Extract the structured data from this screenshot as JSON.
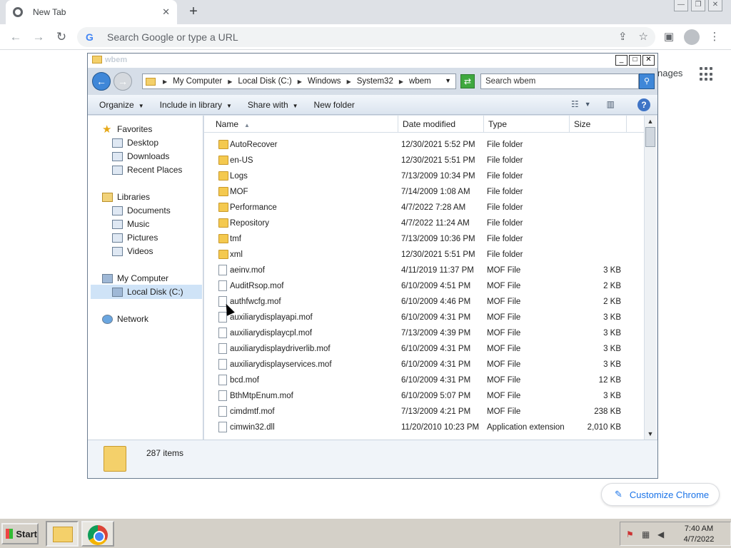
{
  "chrome": {
    "tab_title": "New Tab",
    "tab_close": "✕",
    "new_tab": "+",
    "omnibox_placeholder": "Search Google or type a URL",
    "images_link": "nages",
    "customize_label": "Customize Chrome"
  },
  "explorer": {
    "title": "wbem",
    "breadcrumbs": [
      "My Computer",
      "Local Disk (C:)",
      "Windows",
      "System32",
      "wbem"
    ],
    "search_placeholder": "Search wbem",
    "commands": {
      "organize": "Organize",
      "include": "Include in library",
      "share": "Share with",
      "new_folder": "New folder"
    },
    "nav": {
      "favorites": "Favorites",
      "desktop": "Desktop",
      "downloads": "Downloads",
      "recent": "Recent Places",
      "libraries": "Libraries",
      "documents": "Documents",
      "music": "Music",
      "pictures": "Pictures",
      "videos": "Videos",
      "my_computer": "My Computer",
      "local_disk": "Local Disk (C:)",
      "network": "Network"
    },
    "columns": {
      "name": "Name",
      "date": "Date modified",
      "type": "Type",
      "size": "Size"
    },
    "files": [
      {
        "name": "AutoRecover",
        "date": "12/30/2021 5:52 PM",
        "type": "File folder",
        "size": "",
        "kind": "folder"
      },
      {
        "name": "en-US",
        "date": "12/30/2021 5:51 PM",
        "type": "File folder",
        "size": "",
        "kind": "folder"
      },
      {
        "name": "Logs",
        "date": "7/13/2009 10:34 PM",
        "type": "File folder",
        "size": "",
        "kind": "folder"
      },
      {
        "name": "MOF",
        "date": "7/14/2009 1:08 AM",
        "type": "File folder",
        "size": "",
        "kind": "folder"
      },
      {
        "name": "Performance",
        "date": "4/7/2022 7:28 AM",
        "type": "File folder",
        "size": "",
        "kind": "folder"
      },
      {
        "name": "Repository",
        "date": "4/7/2022 11:24 AM",
        "type": "File folder",
        "size": "",
        "kind": "folder"
      },
      {
        "name": "tmf",
        "date": "7/13/2009 10:36 PM",
        "type": "File folder",
        "size": "",
        "kind": "folder"
      },
      {
        "name": "xml",
        "date": "12/30/2021 5:51 PM",
        "type": "File folder",
        "size": "",
        "kind": "folder"
      },
      {
        "name": "aeinv.mof",
        "date": "4/11/2019 11:37 PM",
        "type": "MOF File",
        "size": "3 KB",
        "kind": "file"
      },
      {
        "name": "AuditRsop.mof",
        "date": "6/10/2009 4:51 PM",
        "type": "MOF File",
        "size": "2 KB",
        "kind": "file"
      },
      {
        "name": "authfwcfg.mof",
        "date": "6/10/2009 4:46 PM",
        "type": "MOF File",
        "size": "2 KB",
        "kind": "file"
      },
      {
        "name": "auxiliarydisplayapi.mof",
        "date": "6/10/2009 4:31 PM",
        "type": "MOF File",
        "size": "3 KB",
        "kind": "file"
      },
      {
        "name": "auxiliarydisplaycpl.mof",
        "date": "7/13/2009 4:39 PM",
        "type": "MOF File",
        "size": "3 KB",
        "kind": "file"
      },
      {
        "name": "auxiliarydisplaydriverlib.mof",
        "date": "6/10/2009 4:31 PM",
        "type": "MOF File",
        "size": "3 KB",
        "kind": "file"
      },
      {
        "name": "auxiliarydisplayservices.mof",
        "date": "6/10/2009 4:31 PM",
        "type": "MOF File",
        "size": "3 KB",
        "kind": "file"
      },
      {
        "name": "bcd.mof",
        "date": "6/10/2009 4:31 PM",
        "type": "MOF File",
        "size": "12 KB",
        "kind": "file"
      },
      {
        "name": "BthMtpEnum.mof",
        "date": "6/10/2009 5:07 PM",
        "type": "MOF File",
        "size": "3 KB",
        "kind": "file"
      },
      {
        "name": "cimdmtf.mof",
        "date": "7/13/2009 4:21 PM",
        "type": "MOF File",
        "size": "238 KB",
        "kind": "file"
      },
      {
        "name": "cimwin32.dll",
        "date": "11/20/2010 10:23 PM",
        "type": "Application extension",
        "size": "2,010 KB",
        "kind": "dll"
      }
    ],
    "item_count": "287 items"
  },
  "taskbar": {
    "start_label": "Start",
    "time": "7:40 AM",
    "date": "4/7/2022"
  },
  "colors": {
    "chrome_tabbar": "#dee1e6",
    "explorer_frame": "#d6dee8",
    "nav_selected": "#cfe3f7",
    "folder": "#f4c94f",
    "taskbar": "#d4d0c8",
    "link": "#1a73e8"
  },
  "icons": [
    "chrome-favicon-icon",
    "close-icon",
    "plus-icon",
    "back-icon",
    "forward-icon",
    "reload-icon",
    "google-g-icon",
    "share-icon",
    "star-icon",
    "side-panel-icon",
    "profile-icon",
    "kebab-menu-icon",
    "apps-grid-icon",
    "pencil-icon",
    "folder-icon",
    "file-icon",
    "search-icon",
    "help-icon",
    "windows-flag-icon",
    "chrome-icon"
  ]
}
